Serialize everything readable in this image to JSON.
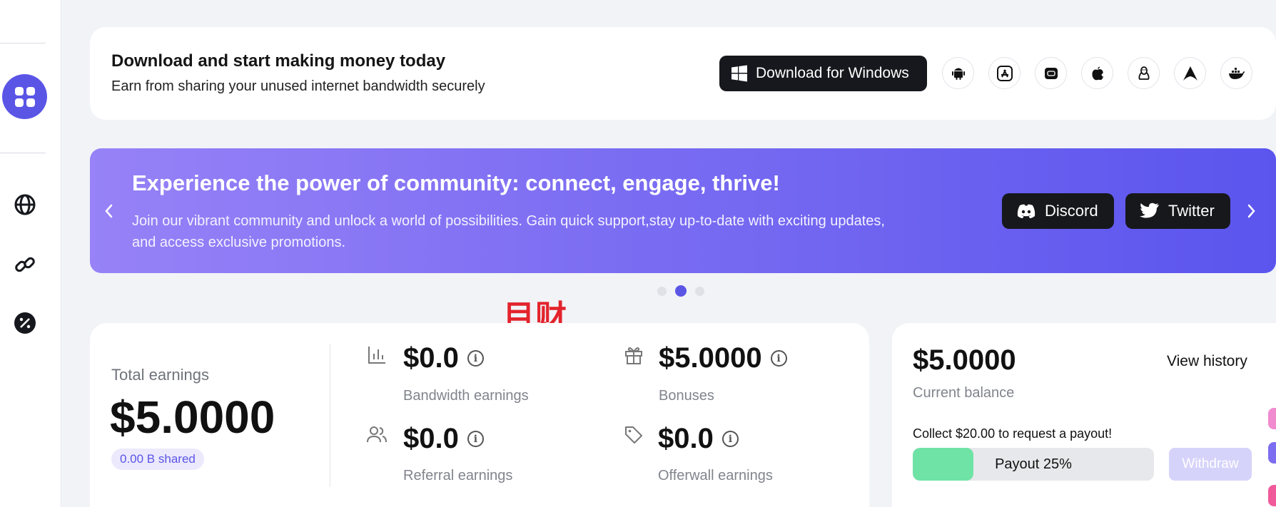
{
  "sidebar": {
    "items": [
      {
        "icon": "dashboard-icon"
      },
      {
        "icon": "globe-icon"
      },
      {
        "icon": "link-icon"
      },
      {
        "icon": "percent-icon"
      }
    ]
  },
  "download": {
    "title": "Download and start making money today",
    "subtitle": "Earn from sharing your unused internet bandwidth securely",
    "button_label": "Download for Windows",
    "platforms": [
      "android-icon",
      "app-store-icon",
      "raspberry-chip-icon",
      "apple-icon",
      "linux-icon",
      "arch-linux-icon",
      "docker-icon"
    ]
  },
  "banner": {
    "title": "Experience the power of community: connect, engage, thrive!",
    "text": "Join our vibrant community and unlock a world of possibilities. Gain quick support,stay up-to-date with exciting updates, and access exclusive promotions.",
    "discord_label": "Discord",
    "twitter_label": "Twitter",
    "slides_total": 3,
    "active_slide": 2
  },
  "watermark": "目财",
  "earnings": {
    "total_label": "Total earnings",
    "total_value": "$5.0000",
    "shared_badge": "0.00 B shared",
    "bandwidth": {
      "value": "$0.0",
      "label": "Bandwidth earnings"
    },
    "bonuses": {
      "value": "$5.0000",
      "label": "Bonuses"
    },
    "referral": {
      "value": "$0.0",
      "label": "Referral earnings"
    },
    "offerwall": {
      "value": "$0.0",
      "label": "Offerwall earnings"
    },
    "info_glyph": "i"
  },
  "balance": {
    "value": "$5.0000",
    "label": "Current balance",
    "view_history": "View history",
    "collect_text": "Collect $20.00 to request a payout!",
    "payout_label": "Payout 25%",
    "payout_percent": 25,
    "withdraw_label": "Withdraw"
  },
  "colors": {
    "accent": "#5b55e6",
    "payout_fill": "#6fe3a6",
    "watermark": "#e3232c"
  }
}
